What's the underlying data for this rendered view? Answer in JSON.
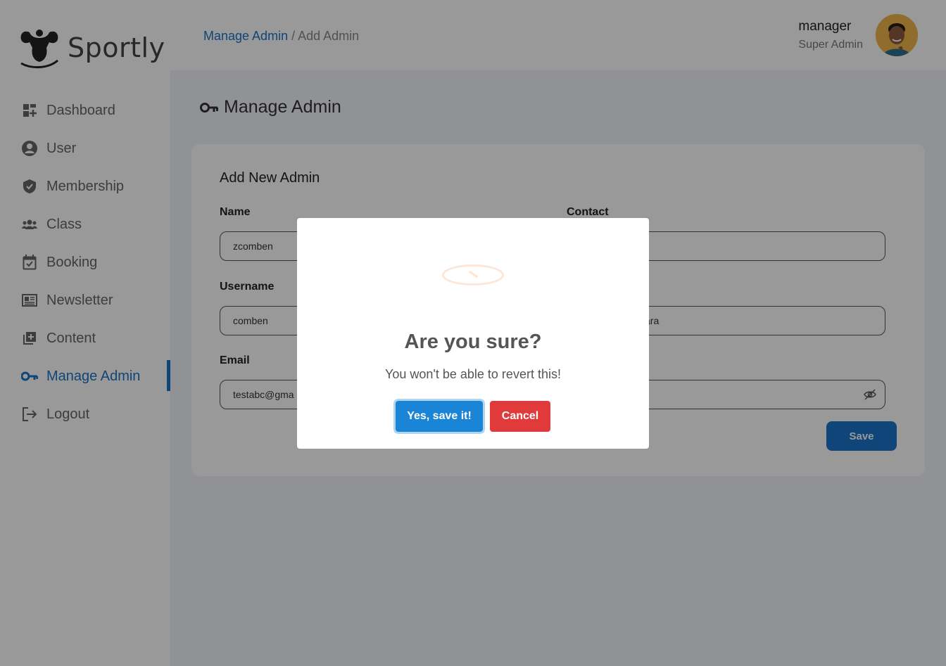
{
  "brand": {
    "name": "Sportly"
  },
  "sidebar": {
    "items": [
      {
        "label": "Dashboard",
        "icon": "dashboard-icon"
      },
      {
        "label": "User",
        "icon": "user-icon"
      },
      {
        "label": "Membership",
        "icon": "shield-icon"
      },
      {
        "label": "Class",
        "icon": "group-icon"
      },
      {
        "label": "Booking",
        "icon": "calendar-check-icon"
      },
      {
        "label": "Newsletter",
        "icon": "newspaper-icon"
      },
      {
        "label": "Content",
        "icon": "add-box-icon"
      },
      {
        "label": "Manage Admin",
        "icon": "key-icon",
        "active": true
      },
      {
        "label": "Logout",
        "icon": "logout-icon"
      }
    ]
  },
  "header": {
    "breadcrumb": {
      "parent": "Manage Admin",
      "separator": " / ",
      "current": "Add Admin"
    },
    "user": {
      "name": "manager",
      "role": "Super Admin"
    }
  },
  "main": {
    "title": "Manage Admin",
    "form": {
      "title": "Add New Admin",
      "name": {
        "label": "Name",
        "value": "zcomben"
      },
      "contact": {
        "label": "Contact",
        "value": ""
      },
      "username": {
        "label": "Username",
        "value": "comben"
      },
      "address": {
        "value": "ara"
      },
      "email": {
        "label": "Email",
        "value": "testabc@gma"
      },
      "password": {
        "value": ""
      },
      "save_label": "Save"
    }
  },
  "dialog": {
    "title": "Are you sure?",
    "text": "You won't be able to revert this!",
    "confirm_label": "Yes, save it!",
    "cancel_label": "Cancel"
  },
  "colors": {
    "accent": "#1a73c8",
    "confirm": "#1a85d6",
    "cancel": "#e03a3a",
    "main_bg": "#f0f4f8"
  }
}
